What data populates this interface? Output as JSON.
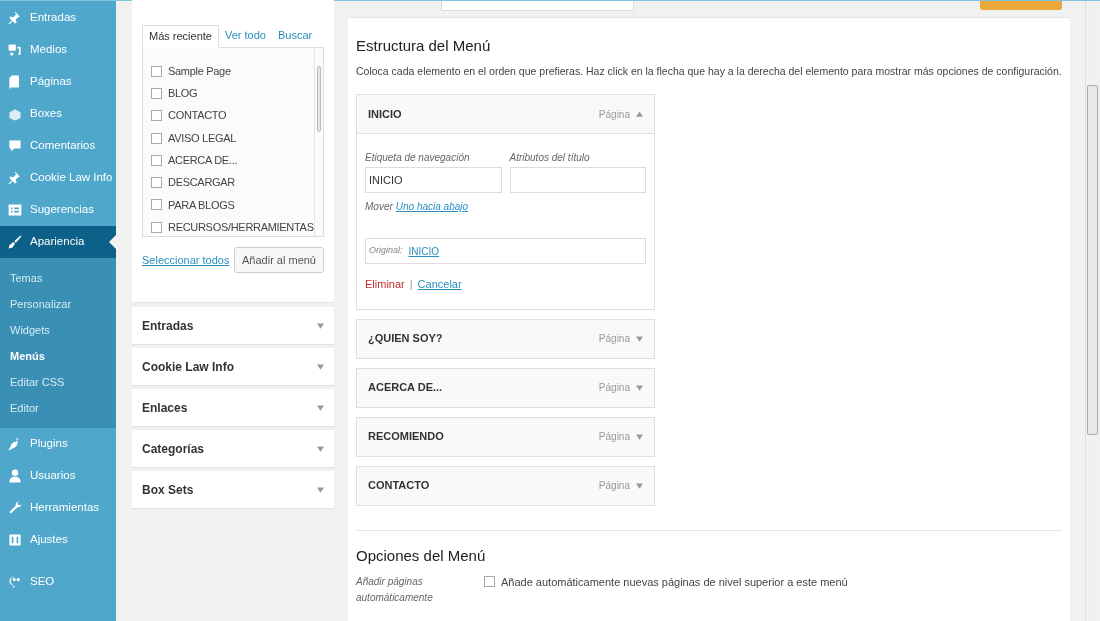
{
  "sidebar": {
    "items": [
      {
        "label": "Entradas",
        "selected": false
      },
      {
        "label": "Medios",
        "selected": false
      },
      {
        "label": "Páginas",
        "selected": false
      },
      {
        "label": "Boxes",
        "selected": false
      },
      {
        "label": "Comentarios",
        "selected": false
      },
      {
        "label": "Cookie Law Info",
        "selected": false
      },
      {
        "label": "Sugerencias",
        "selected": false
      },
      {
        "label": "Apariencia",
        "selected": true,
        "children": [
          {
            "label": "Temas",
            "selected": false
          },
          {
            "label": "Personalizar",
            "selected": false
          },
          {
            "label": "Widgets",
            "selected": false
          },
          {
            "label": "Menús",
            "selected": true
          },
          {
            "label": "Editar CSS",
            "selected": false
          },
          {
            "label": "Editor",
            "selected": false
          }
        ]
      },
      {
        "label": "Plugins",
        "selected": false
      },
      {
        "label": "Usuarios",
        "selected": false
      },
      {
        "label": "Herramientas",
        "selected": false
      },
      {
        "label": "Ajustes",
        "selected": false
      },
      {
        "label": "SEO",
        "selected": false
      }
    ]
  },
  "pages_box": {
    "tabs": [
      {
        "label": "Más reciente",
        "selected": true
      },
      {
        "label": "Ver todo",
        "selected": false
      },
      {
        "label": "Buscar",
        "selected": false
      }
    ],
    "items": [
      {
        "label": "Sample Page",
        "checked": false
      },
      {
        "label": "BLOG",
        "checked": false
      },
      {
        "label": "CONTACTO",
        "checked": false
      },
      {
        "label": "AVISO LEGAL",
        "checked": false
      },
      {
        "label": "ACERCA DE...",
        "checked": false
      },
      {
        "label": "DESCARGAR",
        "checked": false
      },
      {
        "label": "PARA BLOGS",
        "checked": false
      },
      {
        "label": "RECURSOS/HERRAMIENTAS",
        "checked": false
      }
    ],
    "select_all": "Seleccionar todos",
    "add_button": "Añadir al menú"
  },
  "sections": [
    {
      "label": "Entradas",
      "expanded": false
    },
    {
      "label": "Cookie Law Info",
      "expanded": false
    },
    {
      "label": "Enlaces",
      "expanded": false
    },
    {
      "label": "Categorías",
      "expanded": false
    },
    {
      "label": "Box Sets",
      "expanded": false
    }
  ],
  "menu_structure": {
    "title": "Estructura del Menú",
    "description": "Coloca cada elemento en el orden que prefieras. Haz click en la flecha que hay a la derecha del elemento para mostrar más opciones de configuración.",
    "items": [
      {
        "label": "INICIO",
        "type": "Página",
        "expanded": true,
        "nav_label_caption": "Etiqueta de navegación",
        "nav_label_value": "INICIO",
        "title_attr_caption": "Atributos del título",
        "move_label": "Mover",
        "move_link": "Uno hacia abajo",
        "original_label": "Original:",
        "original_link": "INICIO",
        "delete": "Eliminar",
        "separator": "|",
        "cancel": "Cancelar"
      },
      {
        "label": "¿QUIEN SOY?",
        "type": "Página",
        "expanded": false
      },
      {
        "label": "ACERCA DE...",
        "type": "Página",
        "expanded": false
      },
      {
        "label": "RECOMIENDO",
        "type": "Página",
        "expanded": false
      },
      {
        "label": "CONTACTO",
        "type": "Página",
        "expanded": false
      }
    ]
  },
  "menu_options": {
    "title": "Opciones del Menú",
    "auto_add_label": "Añadir páginas automáticamente",
    "auto_add_text": "Añade automáticamente nuevas páginas de nivel superior a este menú",
    "auto_add_checked": false
  }
}
